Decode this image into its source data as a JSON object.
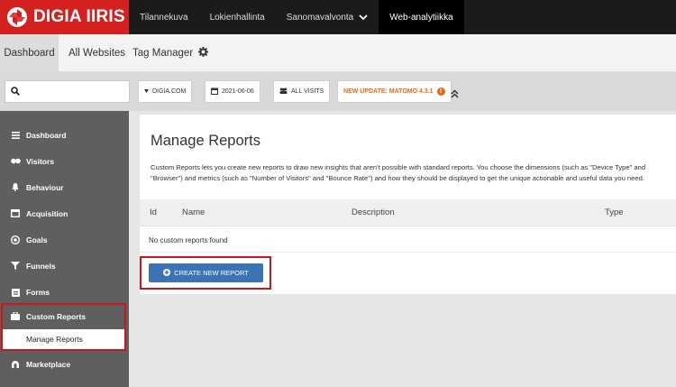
{
  "brand": {
    "name": "DIGIA IIRIS",
    "color": "#d52020"
  },
  "topnav": [
    {
      "label": "Tilannekuva",
      "active": false
    },
    {
      "label": "Lokienhallinta",
      "active": false
    },
    {
      "label": "Sanomavalvonta",
      "active": false,
      "dropdown": true
    },
    {
      "label": "Web-analytiikka",
      "active": true
    }
  ],
  "subnav": {
    "dashboard": "Dashboard",
    "all_websites": "All Websites",
    "tag_manager": "Tag Manager",
    "settings_icon": "gear-icon"
  },
  "filters": {
    "search_placeholder": "",
    "site": "DIGIA.COM",
    "date": "2021-06-06",
    "segment": "ALL VISITS",
    "update": "NEW UPDATE: MATOMO 4.3.1"
  },
  "sidebar": {
    "items": [
      {
        "label": "Dashboard",
        "icon": "dashboard-icon"
      },
      {
        "label": "Visitors",
        "icon": "visitors-icon"
      },
      {
        "label": "Behaviour",
        "icon": "behaviour-icon"
      },
      {
        "label": "Acquisition",
        "icon": "acquisition-icon"
      },
      {
        "label": "Goals",
        "icon": "goals-icon"
      },
      {
        "label": "Funnels",
        "icon": "funnel-icon"
      },
      {
        "label": "Forms",
        "icon": "forms-icon"
      },
      {
        "label": "Custom Reports",
        "icon": "custom-reports-icon"
      },
      {
        "label": "Marketplace",
        "icon": "marketplace-icon"
      }
    ],
    "sub_item": "Manage Reports"
  },
  "main": {
    "title": "Manage Reports",
    "description": "Custom Reports lets you create new reports to draw new insights that aren't possible with standard reports. You choose the dimensions (such as \"Device Type\" and \"Browser\") and metrics (such as \"Number of Visitors\" and \"Bounce Rate\") and how they should be displayed to get the unique actionable and useful data you need.",
    "columns": {
      "id": "Id",
      "name": "Name",
      "description": "Description",
      "type": "Type"
    },
    "empty_text": "No custom reports found",
    "create_button": "CREATE NEW REPORT"
  },
  "colors": {
    "accent": "#3b73b5",
    "highlight": "#c8161d",
    "update": "#e06a1b"
  }
}
